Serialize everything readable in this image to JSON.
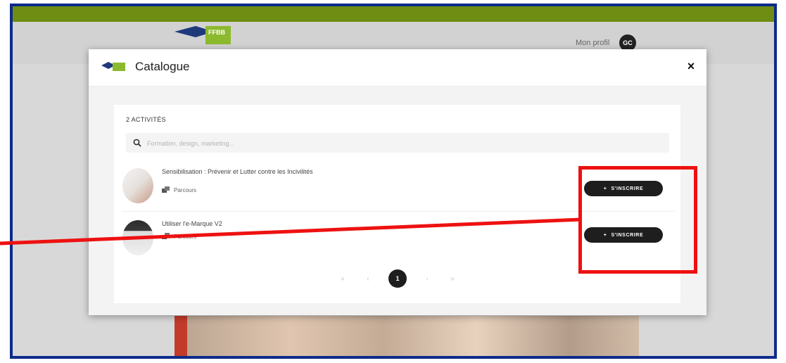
{
  "app": {
    "logo_text": "FFBB",
    "profile_label": "Mon profil",
    "avatar_initials": "GC"
  },
  "modal": {
    "title": "Catalogue",
    "close_label": "×",
    "count_label": "2 ACTIVITÉS",
    "search_placeholder": "Formation, design, marketing...",
    "activities": [
      {
        "title": "Sensibilisation : Prévenir et Lutter contre les Incivilités",
        "type": "Parcours",
        "button_label": "S'INSCRIRE",
        "button_icon": "+"
      },
      {
        "title": "Utiliser l'e-Marque V2",
        "type": "Parcours",
        "button_label": "S'INSCRIRE",
        "button_icon": "+"
      }
    ],
    "pagination": {
      "first": "«",
      "prev": "‹",
      "current": "1",
      "next": "›",
      "last": "»"
    }
  },
  "colors": {
    "frame": "#0d2b8a",
    "topbar": "#6f8d12",
    "button": "#1e1e1e",
    "annotation": "#ee1111"
  },
  "icons": [
    "ffbb-logo",
    "search-icon",
    "close-icon",
    "parcours-icon",
    "plus-icon"
  ]
}
